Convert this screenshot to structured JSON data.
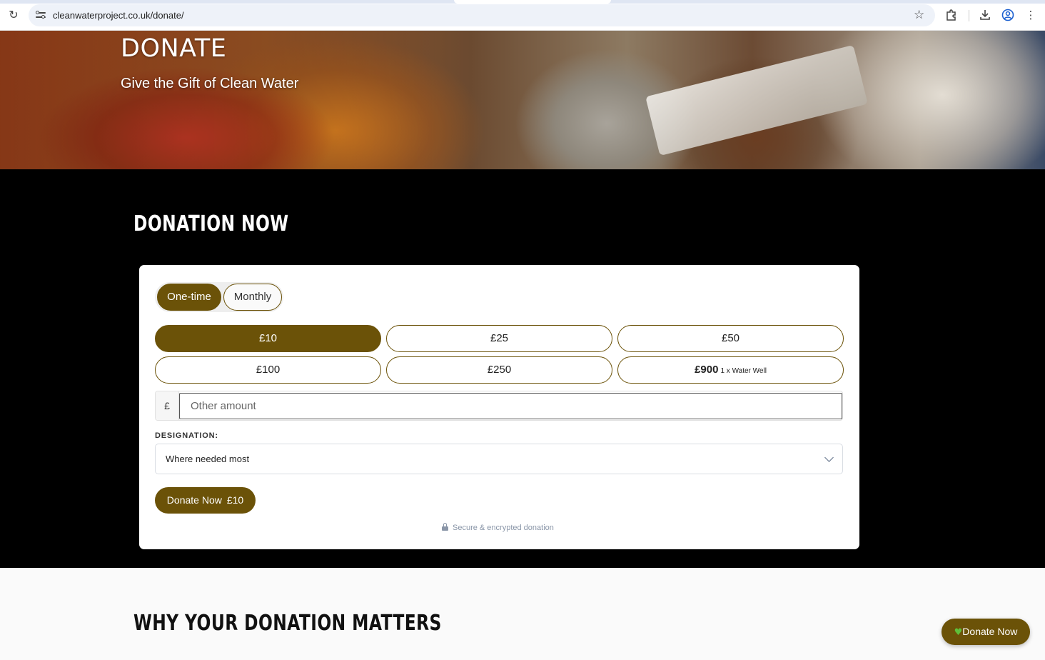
{
  "browser": {
    "url": "cleanwaterproject.co.uk/donate/",
    "icons": [
      "reload-icon",
      "site-info-icon",
      "bookmark-star-icon",
      "extensions-icon",
      "download-icon",
      "profile-icon",
      "menu-icon"
    ]
  },
  "hero": {
    "title": "DONATE",
    "subtitle": "Give the Gift of Clean Water"
  },
  "donation": {
    "section_title": "DONATION NOW",
    "frequency": {
      "options": [
        "One-time",
        "Monthly"
      ],
      "selected": "One-time"
    },
    "amounts": [
      {
        "label": "£10",
        "selected": true
      },
      {
        "label": "£25",
        "selected": false
      },
      {
        "label": "£50",
        "selected": false
      },
      {
        "label": "£100",
        "selected": false
      },
      {
        "label": "£250",
        "selected": false
      },
      {
        "label": "£900",
        "sublabel": "1 x Water Well",
        "selected": false
      }
    ],
    "other": {
      "currency_symbol": "£",
      "placeholder": "Other amount"
    },
    "designation": {
      "label": "DESIGNATION:",
      "value": "Where needed most"
    },
    "submit": {
      "label": "Donate Now",
      "amount": "£10"
    },
    "secure_note": "Secure & encrypted donation"
  },
  "why": {
    "title": "WHY YOUR DONATION MATTERS"
  },
  "floating_button": {
    "label": "Donate Now",
    "icon": "green-heart-icon"
  },
  "colors": {
    "accent": "#6b5208",
    "dark_bg": "#000000",
    "card_bg": "#ffffff",
    "secure_text": "#8a96a8"
  }
}
